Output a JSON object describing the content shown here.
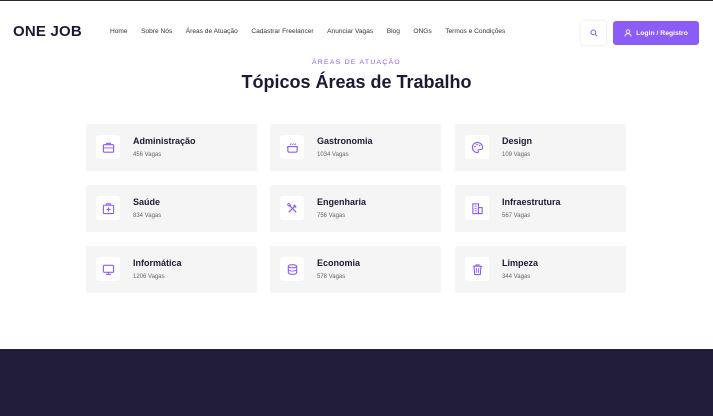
{
  "header": {
    "logo": "ONE JOB",
    "nav": [
      "Home",
      "Sobre Nós",
      "Áreas de Atuação",
      "Cadastrar Freelancer",
      "Anunciar Vagas",
      "Blog",
      "ONGs",
      "Termos e Condições"
    ],
    "login_label": "Login / Registro"
  },
  "section": {
    "eyebrow": "ÁREAS DE ATUAÇÃO",
    "title": "Tópicos Áreas de Trabalho"
  },
  "categories": [
    {
      "name": "Administração",
      "count": "456 Vagas",
      "icon": "briefcase-icon"
    },
    {
      "name": "Gastronomia",
      "count": "1034 Vagas",
      "icon": "cooking-pot-icon"
    },
    {
      "name": "Design",
      "count": "109 Vagas",
      "icon": "palette-icon"
    },
    {
      "name": "Saúde",
      "count": "834 Vagas",
      "icon": "medical-kit-icon"
    },
    {
      "name": "Engenharia",
      "count": "756 Vagas",
      "icon": "tools-icon"
    },
    {
      "name": "Infraestrutura",
      "count": "567 Vagas",
      "icon": "building-icon"
    },
    {
      "name": "Informática",
      "count": "1206 Vagas",
      "icon": "monitor-icon"
    },
    {
      "name": "Economia",
      "count": "578 Vagas",
      "icon": "coins-icon"
    },
    {
      "name": "Limpeza",
      "count": "344 Vagas",
      "icon": "trash-icon"
    }
  ],
  "colors": {
    "accent": "#8b5cf6",
    "dark": "#221d3a",
    "card_bg": "#f5f5f5"
  }
}
